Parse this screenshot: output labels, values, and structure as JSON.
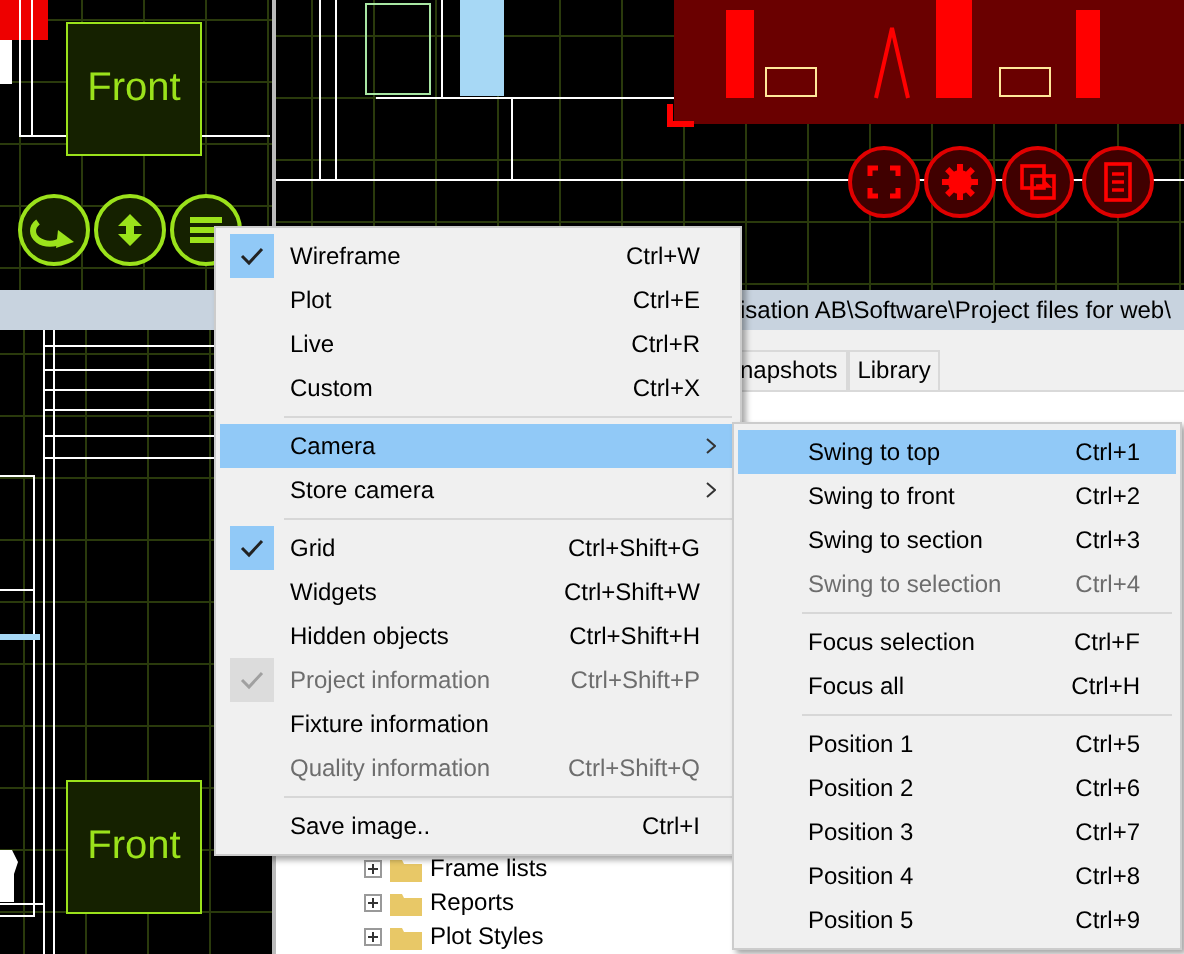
{
  "viewports": [
    {
      "label": "Front"
    },
    {
      "label": "Front"
    }
  ],
  "path_bar": {
    "text": "isation AB\\Software\\Project files for web\\"
  },
  "tabs": [
    {
      "label": "napshots",
      "selected": false
    },
    {
      "label": "Library",
      "selected": false
    }
  ],
  "tree": [
    {
      "label": "Frame lists"
    },
    {
      "label": "Reports"
    },
    {
      "label": "Plot Styles"
    }
  ],
  "menu": {
    "items": [
      {
        "kind": "item",
        "label": "Wireframe",
        "shortcut": "Ctrl+W",
        "checked": true,
        "disabled": false
      },
      {
        "kind": "item",
        "label": "Plot",
        "shortcut": "Ctrl+E",
        "checked": false,
        "disabled": false
      },
      {
        "kind": "item",
        "label": "Live",
        "shortcut": "Ctrl+R",
        "checked": false,
        "disabled": false
      },
      {
        "kind": "item",
        "label": "Custom",
        "shortcut": "Ctrl+X",
        "checked": false,
        "disabled": false
      },
      {
        "kind": "separator"
      },
      {
        "kind": "submenu",
        "label": "Camera",
        "selected": true
      },
      {
        "kind": "submenu",
        "label": "Store camera",
        "selected": false
      },
      {
        "kind": "separator"
      },
      {
        "kind": "item",
        "label": "Grid",
        "shortcut": "Ctrl+Shift+G",
        "checked": true,
        "disabled": false
      },
      {
        "kind": "item",
        "label": "Widgets",
        "shortcut": "Ctrl+Shift+W",
        "checked": false,
        "disabled": false
      },
      {
        "kind": "item",
        "label": "Hidden objects",
        "shortcut": "Ctrl+Shift+H",
        "checked": false,
        "disabled": false
      },
      {
        "kind": "item",
        "label": "Project information",
        "shortcut": "Ctrl+Shift+P",
        "checked": true,
        "disabled": true
      },
      {
        "kind": "item",
        "label": "Fixture information",
        "checked": false,
        "disabled": false
      },
      {
        "kind": "item",
        "label": "Quality information",
        "shortcut": "Ctrl+Shift+Q",
        "checked": false,
        "disabled": true
      },
      {
        "kind": "separator"
      },
      {
        "kind": "item",
        "label": "Save image..",
        "shortcut": "Ctrl+I",
        "checked": false,
        "disabled": false
      }
    ]
  },
  "submenu": {
    "items": [
      {
        "kind": "item",
        "label": "Swing to top",
        "shortcut": "Ctrl+1",
        "selected": true,
        "disabled": false
      },
      {
        "kind": "item",
        "label": "Swing to front",
        "shortcut": "Ctrl+2",
        "selected": false,
        "disabled": false
      },
      {
        "kind": "item",
        "label": "Swing to section",
        "shortcut": "Ctrl+3",
        "selected": false,
        "disabled": false
      },
      {
        "kind": "item",
        "label": "Swing to selection",
        "shortcut": "Ctrl+4",
        "selected": false,
        "disabled": true
      },
      {
        "kind": "separator"
      },
      {
        "kind": "item",
        "label": "Focus selection",
        "shortcut": "Ctrl+F",
        "selected": false,
        "disabled": false
      },
      {
        "kind": "item",
        "label": "Focus all",
        "shortcut": "Ctrl+H",
        "selected": false,
        "disabled": false
      },
      {
        "kind": "separator"
      },
      {
        "kind": "item",
        "label": "Position 1",
        "shortcut": "Ctrl+5",
        "selected": false,
        "disabled": false
      },
      {
        "kind": "item",
        "label": "Position 2",
        "shortcut": "Ctrl+6",
        "selected": false,
        "disabled": false
      },
      {
        "kind": "item",
        "label": "Position 3",
        "shortcut": "Ctrl+7",
        "selected": false,
        "disabled": false
      },
      {
        "kind": "item",
        "label": "Position 4",
        "shortcut": "Ctrl+8",
        "selected": false,
        "disabled": false
      },
      {
        "kind": "item",
        "label": "Position 5",
        "shortcut": "Ctrl+9",
        "selected": false,
        "disabled": false
      }
    ]
  }
}
